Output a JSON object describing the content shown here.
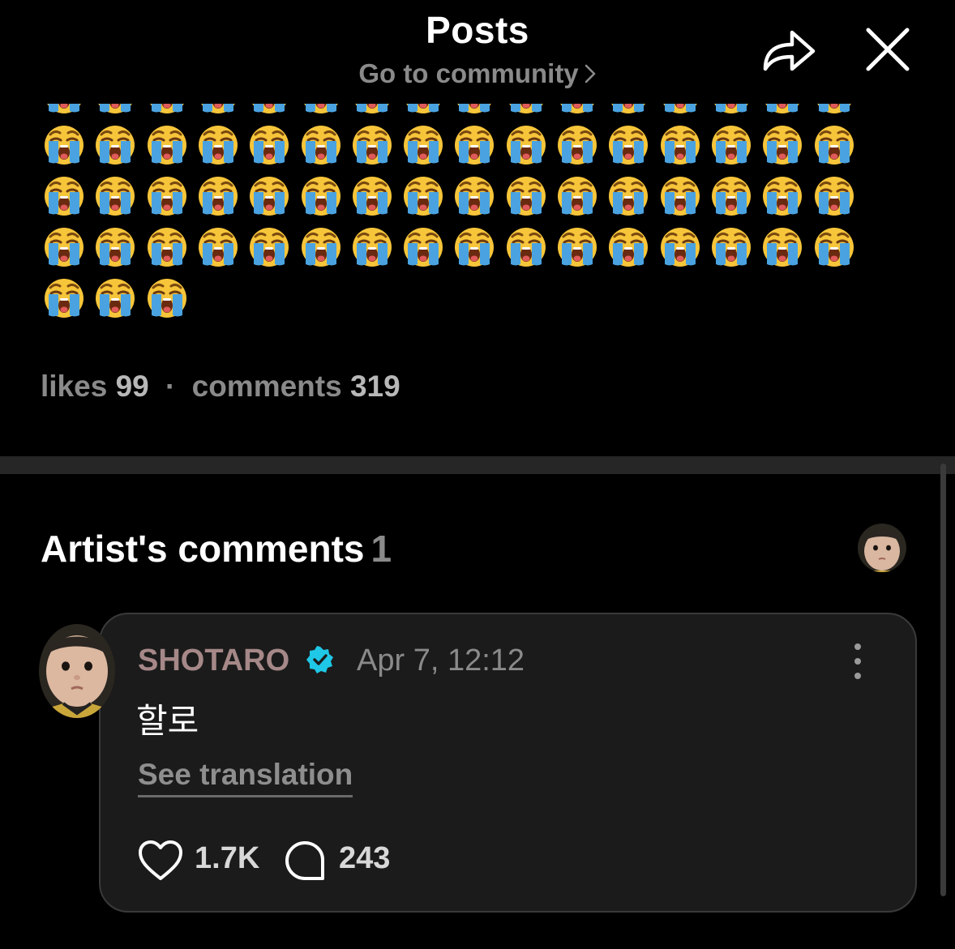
{
  "header": {
    "title": "Posts",
    "community_link": "Go to community",
    "share_icon": "share-icon",
    "close_icon": "close-icon"
  },
  "post": {
    "emoji_char": "😭",
    "emoji_rows": [
      16,
      16,
      16,
      16,
      3
    ],
    "likes_label": "likes",
    "likes_count": "99",
    "separator": "·",
    "comments_label": "comments",
    "comments_count": "319"
  },
  "artist_comments": {
    "title": "Artist's comments",
    "count": "1"
  },
  "comment": {
    "author": "SHOTARO",
    "date": "Apr 7, 12:12",
    "text": "할로",
    "translate_label": "See translation",
    "likes": "1.7K",
    "replies": "243"
  },
  "colors": {
    "background": "#000000",
    "card": "#1b1b1b",
    "muted": "#8a8a8a",
    "author": "#a68888",
    "verified": "#1ec8e6"
  }
}
